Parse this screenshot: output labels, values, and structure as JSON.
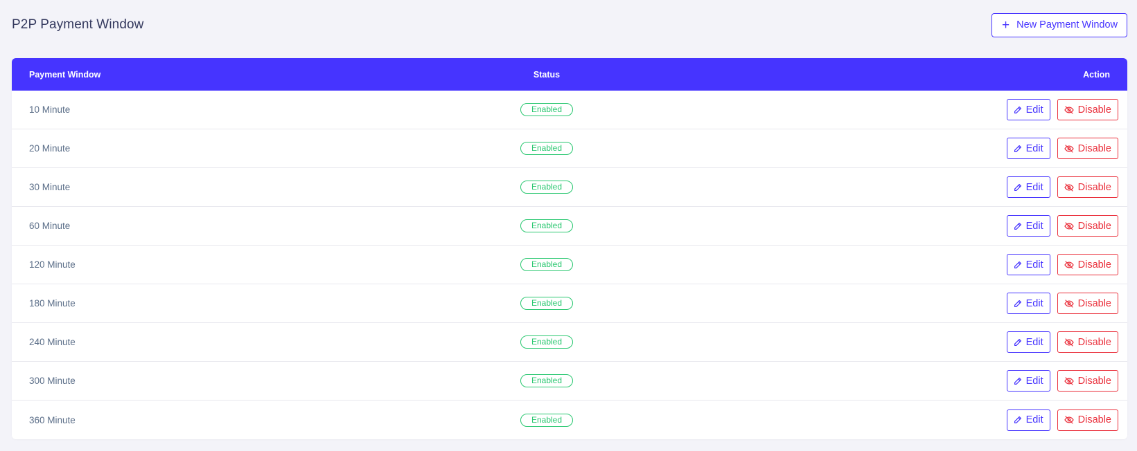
{
  "header": {
    "title": "P2P Payment Window",
    "new_button_label": "New Payment Window",
    "new_button_icon": "plus-icon"
  },
  "table": {
    "columns": [
      "Payment Window",
      "Status",
      "Action"
    ],
    "rows": [
      {
        "window": "10 Minute",
        "status": "Enabled",
        "edit_label": "Edit",
        "disable_label": "Disable"
      },
      {
        "window": "20 Minute",
        "status": "Enabled",
        "edit_label": "Edit",
        "disable_label": "Disable"
      },
      {
        "window": "30 Minute",
        "status": "Enabled",
        "edit_label": "Edit",
        "disable_label": "Disable"
      },
      {
        "window": "60 Minute",
        "status": "Enabled",
        "edit_label": "Edit",
        "disable_label": "Disable"
      },
      {
        "window": "120 Minute",
        "status": "Enabled",
        "edit_label": "Edit",
        "disable_label": "Disable"
      },
      {
        "window": "180 Minute",
        "status": "Enabled",
        "edit_label": "Edit",
        "disable_label": "Disable"
      },
      {
        "window": "240 Minute",
        "status": "Enabled",
        "edit_label": "Edit",
        "disable_label": "Disable"
      },
      {
        "window": "300 Minute",
        "status": "Enabled",
        "edit_label": "Edit",
        "disable_label": "Disable"
      },
      {
        "window": "360 Minute",
        "status": "Enabled",
        "edit_label": "Edit",
        "disable_label": "Disable"
      }
    ]
  },
  "icons": {
    "edit": "pencil-icon",
    "disable": "eye-slash-icon"
  },
  "colors": {
    "primary": "#4634ff",
    "success": "#28c76f",
    "danger": "#ea2e3a",
    "background": "#f3f3f9"
  }
}
